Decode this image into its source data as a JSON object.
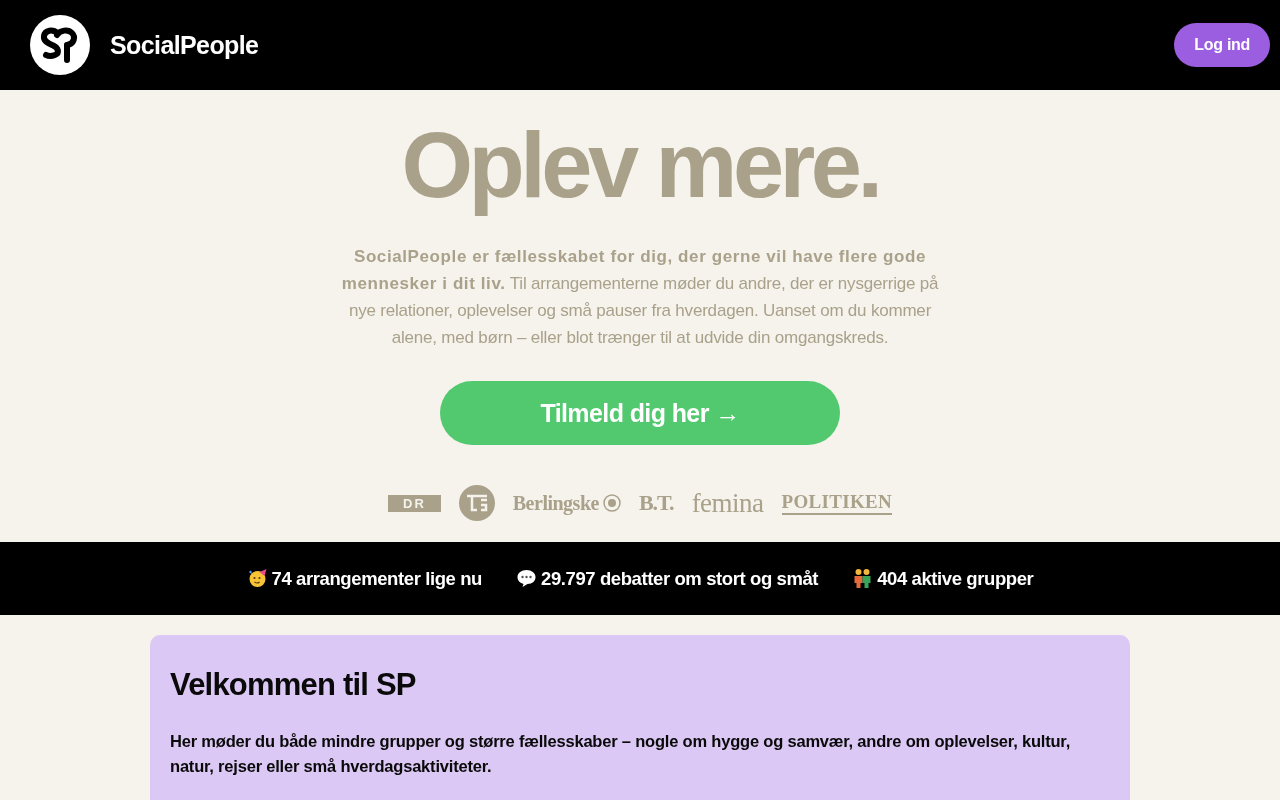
{
  "header": {
    "brand": "SocialPeople",
    "login_button": "Log ind"
  },
  "hero": {
    "title": "Oplev mere.",
    "intro": "**SocialPeople er fællesskabet for dig, der gerne vil have flere gode mennesker i dit liv.** Til arrangementerne møder du andre, der er nysgerrige på nye relationer, oplevelser og små pauser fra hverdagen. Uanset om du kommer alene, med børn – eller blot trænger til at udvide din omgangskreds.",
    "signup_button": "Tilmeld dig her →",
    "press_logos": [
      {
        "kind": "boxed",
        "label": "DR"
      },
      {
        "kind": "circle"
      },
      {
        "kind": "serif",
        "label": "Berlingske",
        "crest": true
      },
      {
        "kind": "heavy",
        "label": "B.T."
      },
      {
        "kind": "light",
        "label": "femina"
      },
      {
        "kind": "underlined",
        "label": "POLITIKEN"
      }
    ]
  },
  "stats": [
    {
      "kind": "party",
      "label": "74 arrangementer lige nu"
    },
    {
      "kind": "chat",
      "label": "29.797 debatter om stort og småt"
    },
    {
      "kind": "people",
      "label": "404 aktive grupper"
    }
  ],
  "welcome": {
    "title": "Velkommen til SP",
    "lead": "Her møder du både mindre grupper og større fællesskaber – nogle om hygge og samvær, andre om oplevelser, kultur, natur, rejser eller små hverdagsaktiviteter."
  }
}
